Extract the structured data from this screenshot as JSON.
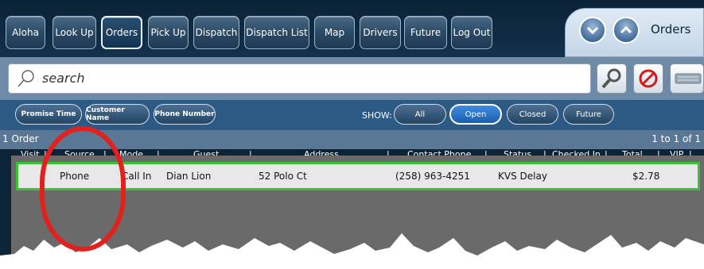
{
  "nav": {
    "buttons": [
      "Aloha",
      "Look Up",
      "Orders",
      "Pick Up",
      "Dispatch",
      "Dispatch List",
      "Map",
      "Drivers",
      "Future",
      "Log Out"
    ],
    "active": "Orders"
  },
  "orders_tab": {
    "label": "Orders"
  },
  "search": {
    "placeholder": "search"
  },
  "sort_buttons": [
    "Promise Time",
    "Customer Name",
    "Phone Number"
  ],
  "show": {
    "label": "SHOW:",
    "options": [
      "All",
      "Open",
      "Closed",
      "Future"
    ],
    "active": "Open"
  },
  "info": {
    "count": "1 Order",
    "range": "1 to 1 of 1"
  },
  "table": {
    "headers": [
      "Visit",
      "Source",
      "Mode",
      "Guest",
      "Address",
      "Contact Phone",
      "Status",
      "Checked In",
      "Total",
      "VIP"
    ],
    "rows": [
      {
        "visit": "",
        "source": "Phone",
        "mode": "Call In",
        "guest": "Dian Lion",
        "address": "52 Polo Ct",
        "contact_phone": "(258) 963-4251",
        "status": "KVS Delay",
        "checked_in": "",
        "total": "$2.78",
        "vip": ""
      }
    ]
  },
  "colors": {
    "selected_row_border": "#37c334",
    "annotation": "#e3201b"
  }
}
